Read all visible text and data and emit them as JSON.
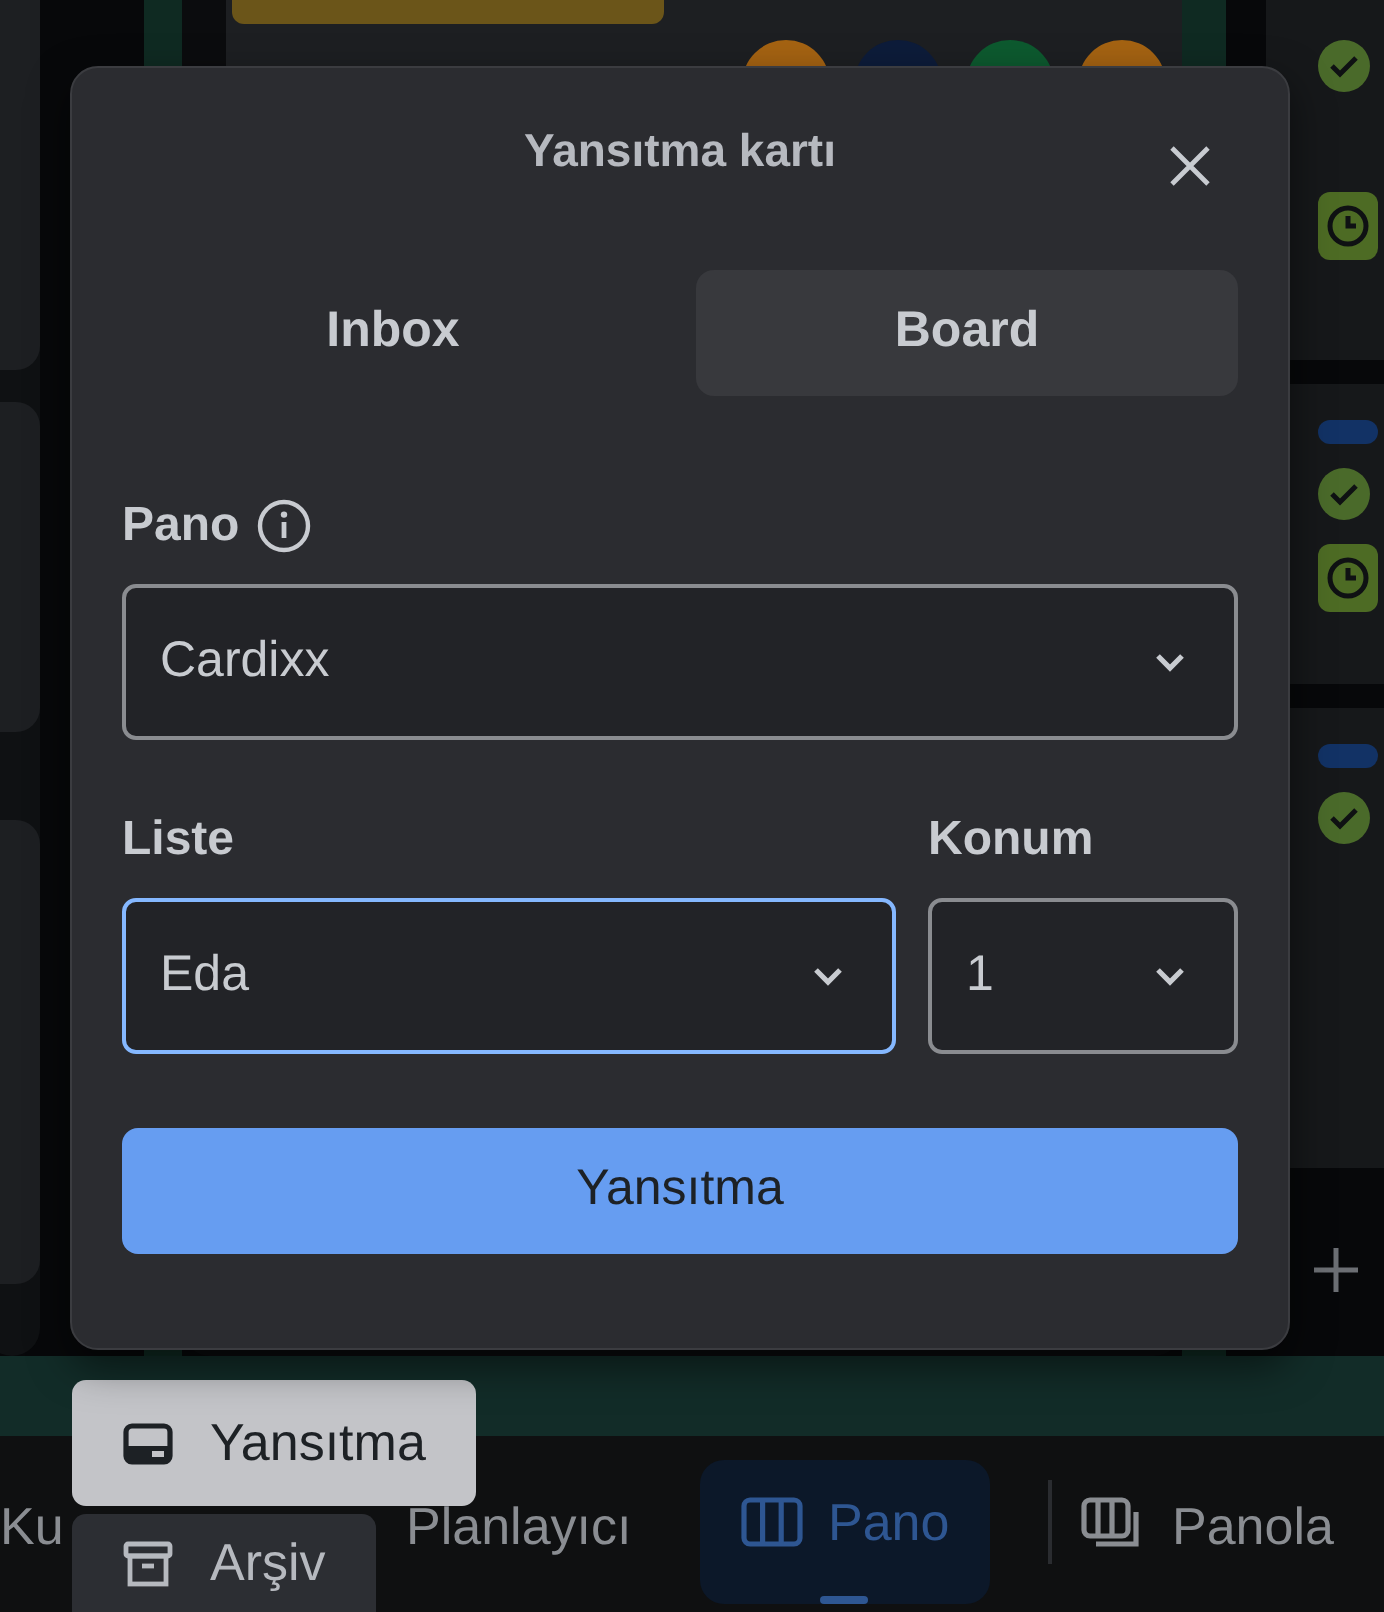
{
  "dialog": {
    "title": "Yansıtma kartı",
    "tabs": [
      {
        "label": "Inbox",
        "selected": false
      },
      {
        "label": "Board",
        "selected": true
      }
    ],
    "fields": [
      {
        "label": "Pano",
        "info": true,
        "value": "Cardixx",
        "focused": false
      },
      {
        "label": "Liste",
        "value": "Eda",
        "focused": true
      },
      {
        "label": "Konum",
        "value": "1",
        "focused": false
      }
    ],
    "submit": "Yansıtma"
  },
  "menu": [
    {
      "label": "Yansıtma",
      "kind": "card",
      "highlighted": true
    },
    {
      "label": "Arşiv",
      "kind": "archive",
      "highlighted": false
    }
  ],
  "bottom_nav": [
    {
      "label": "Ku",
      "kind": "none",
      "selected": false
    },
    {
      "label": "Planlayıcı",
      "kind": "none",
      "selected": false
    },
    {
      "label": "Pano",
      "kind": "board",
      "selected": true
    },
    {
      "label": "Panola",
      "kind": "boards",
      "selected": false
    }
  ]
}
